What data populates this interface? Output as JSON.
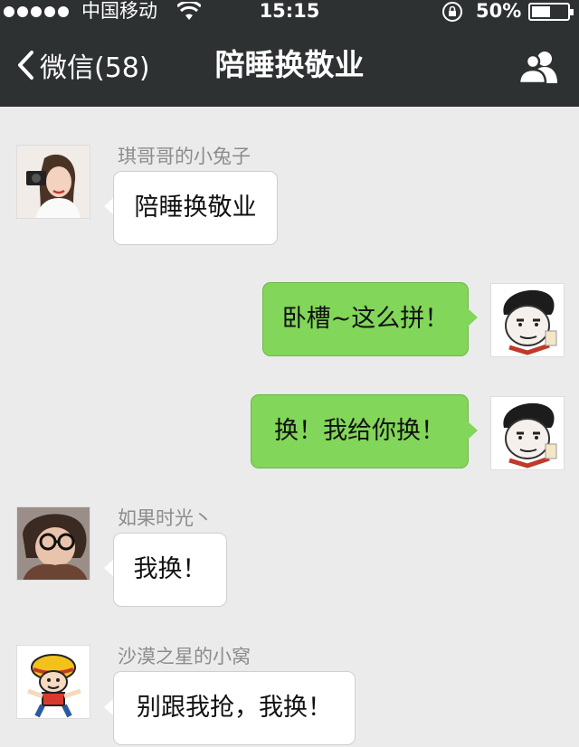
{
  "status_bar": {
    "carrier": "中国移动",
    "time": "15:15",
    "battery": "50%"
  },
  "nav": {
    "back_label": "微信(58)",
    "title": "陪睡换敬业"
  },
  "messages": [
    {
      "sender": "琪哥哥的小兔子",
      "text": "陪睡换敬业",
      "direction": "incoming",
      "avatar": "girl-camera-avatar"
    },
    {
      "sender": "",
      "text": "卧槽~这么拼！",
      "direction": "outgoing",
      "avatar": "meme-face-avatar"
    },
    {
      "sender": "",
      "text": "换！我给你换！",
      "direction": "outgoing",
      "avatar": "meme-face-avatar"
    },
    {
      "sender": "如果时光丶",
      "text": "我换！",
      "direction": "incoming",
      "avatar": "glasses-person-avatar"
    },
    {
      "sender": "沙漠之星的小窝",
      "text": "别跟我抢，我换！",
      "direction": "incoming",
      "avatar": "cartoon-pirate-avatar"
    }
  ],
  "colors": {
    "nav_bg": "#2e3132",
    "chat_bg": "#ebebeb",
    "outgoing_bubble": "#82d659",
    "incoming_bubble": "#ffffff"
  }
}
